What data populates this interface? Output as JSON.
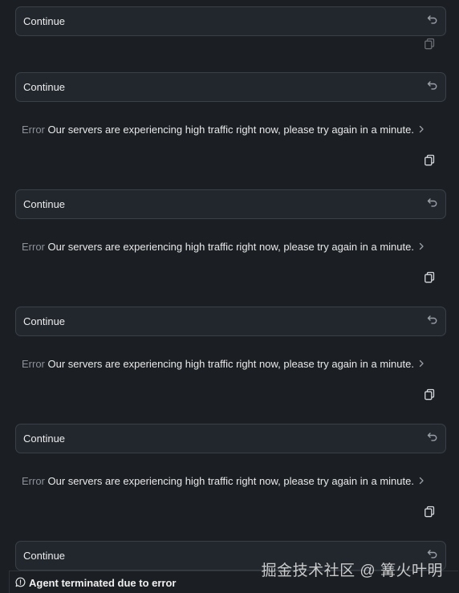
{
  "messages": [
    {
      "user_text": "Continue",
      "error_label": "",
      "error_text": ""
    },
    {
      "user_text": "Continue",
      "error_label": "Error",
      "error_text": "Our servers are experiencing high traffic right now, please try again in a minute."
    },
    {
      "user_text": "Continue",
      "error_label": "Error",
      "error_text": "Our servers are experiencing high traffic right now, please try again in a minute."
    },
    {
      "user_text": "Continue",
      "error_label": "Error",
      "error_text": "Our servers are experiencing high traffic right now, please try again in a minute."
    },
    {
      "user_text": "Continue",
      "error_label": "Error",
      "error_text": "Our servers are experiencing high traffic right now, please try again in a minute."
    },
    {
      "user_text": "Continue",
      "error_label": "",
      "error_text": ""
    }
  ],
  "status": {
    "text": "Agent terminated due to error",
    "icon": "chat-bubble-icon"
  },
  "watermark": "掘金技术社区 @ 篝火叶明",
  "icons": {
    "revert": "undo-icon",
    "expand": "chevron-right-icon",
    "copy": "copy-icon"
  }
}
